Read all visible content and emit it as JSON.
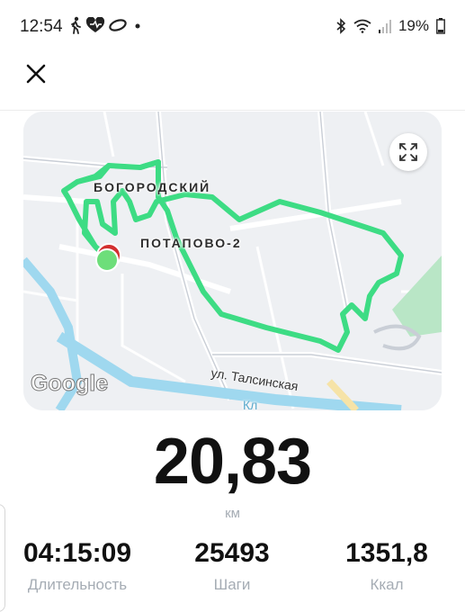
{
  "status_bar": {
    "time": "12:54",
    "battery": "19%",
    "icons": [
      "walking-icon",
      "heart-icon",
      "ring-icon",
      "dot-icon",
      "bluetooth-icon",
      "wifi-icon",
      "signal-icon",
      "battery-icon"
    ]
  },
  "header": {
    "close_icon": "close-icon"
  },
  "map": {
    "labels": {
      "district1": "БОГОРОДСКИЙ",
      "district2": "ПОТАПОВО-2",
      "street": "ул. Талсинская",
      "street_partial": "Кл"
    },
    "logo": "Google",
    "expand_icon": "expand-icon",
    "route_color": "#3ddc84",
    "start_marker_color": "#3ddc84",
    "end_marker_color": "#d32f2f"
  },
  "summary": {
    "distance": "20,83",
    "distance_unit": "км",
    "stats": [
      {
        "value": "04:15:09",
        "label": "Длительность"
      },
      {
        "value": "25493",
        "label": "Шаги"
      },
      {
        "value": "1351,8",
        "label": "Ккал"
      }
    ]
  }
}
